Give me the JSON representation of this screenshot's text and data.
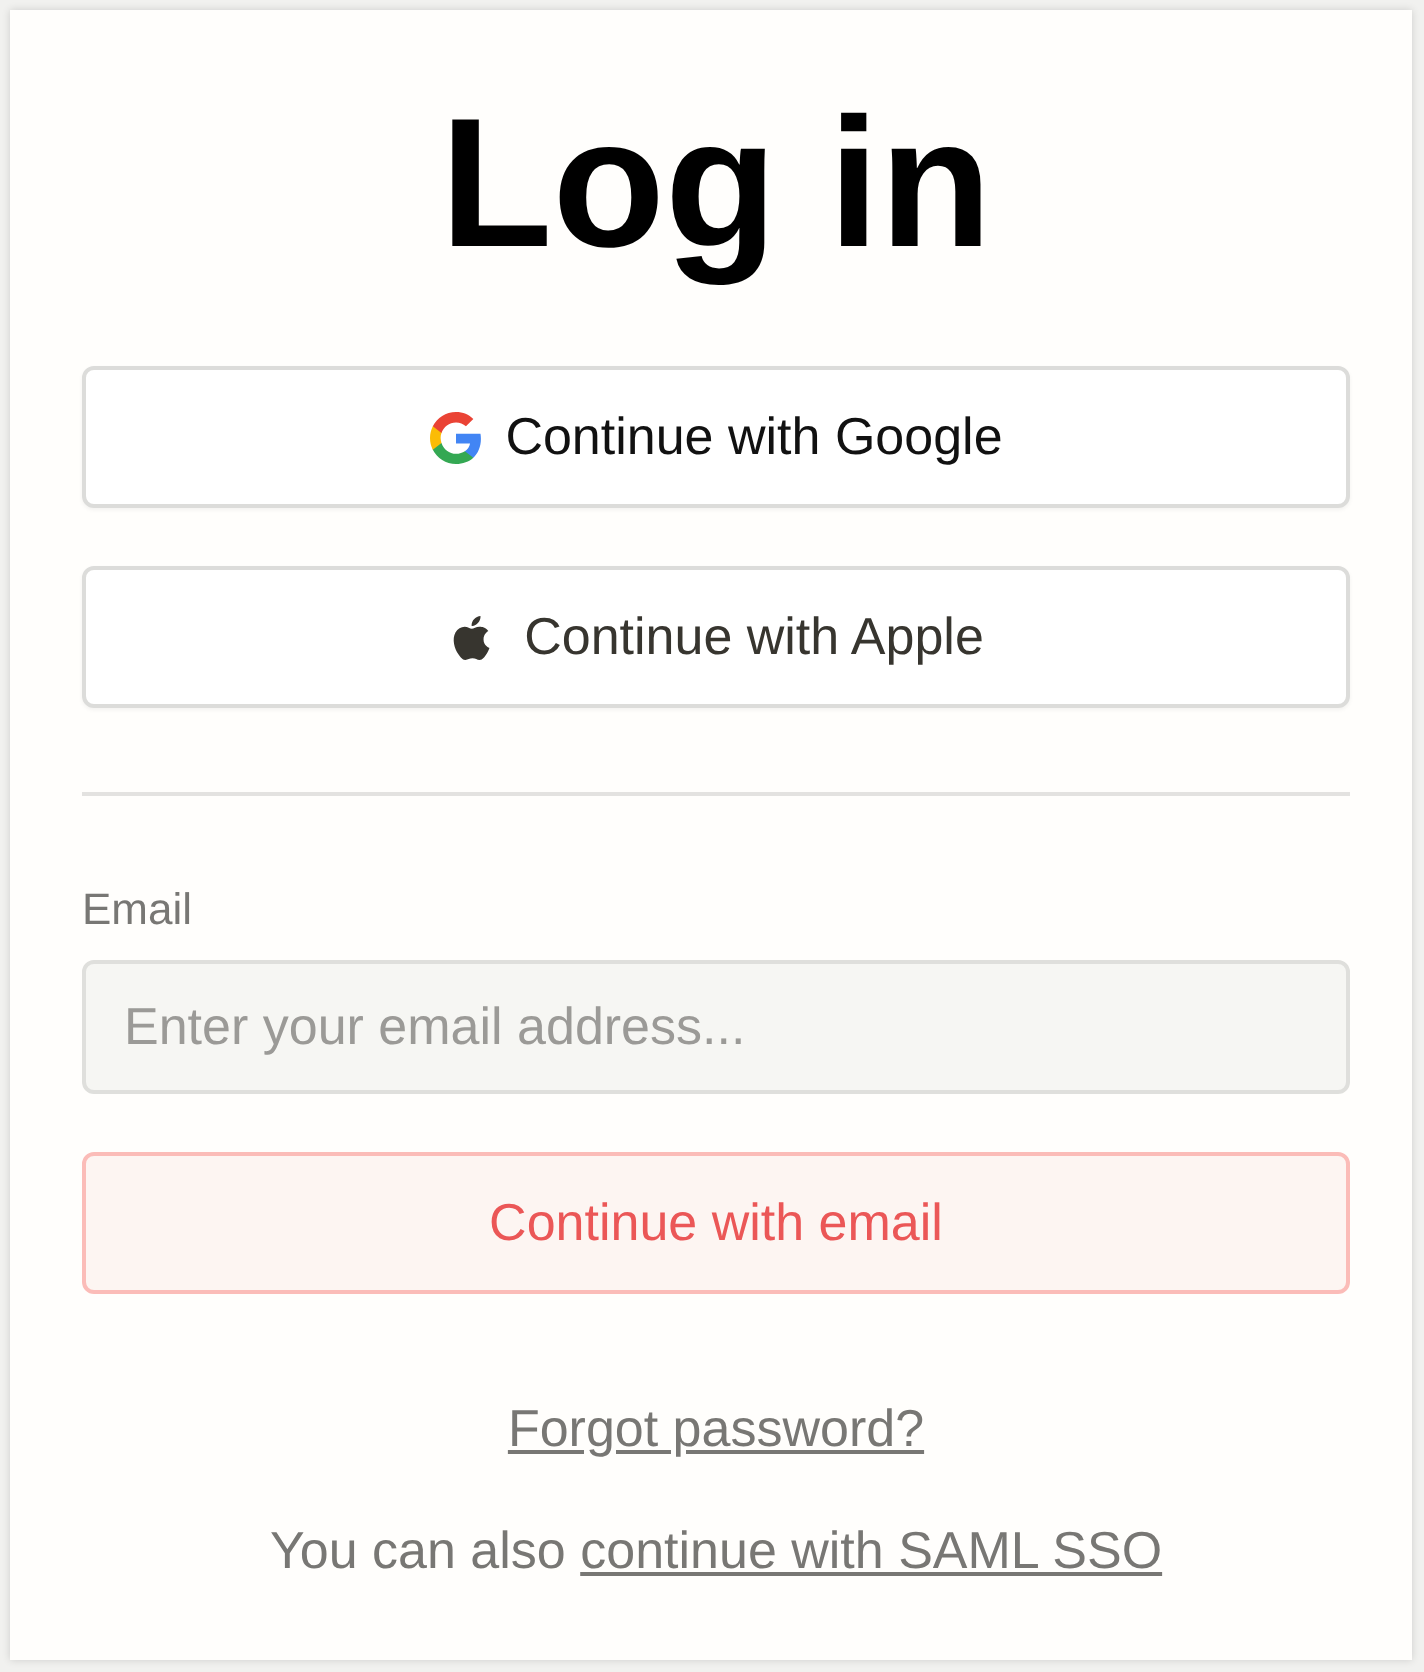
{
  "title": "Log in",
  "providers": [
    {
      "kind": "google",
      "label": "Continue with Google"
    },
    {
      "kind": "apple",
      "label": "Continue with Apple"
    }
  ],
  "email": {
    "label": "Email",
    "placeholder": "Enter your email address..."
  },
  "submit": "Continue with email",
  "forgot": "Forgot password?",
  "sso": {
    "text": "You can also",
    "link": "continue with SAML SSO"
  }
}
